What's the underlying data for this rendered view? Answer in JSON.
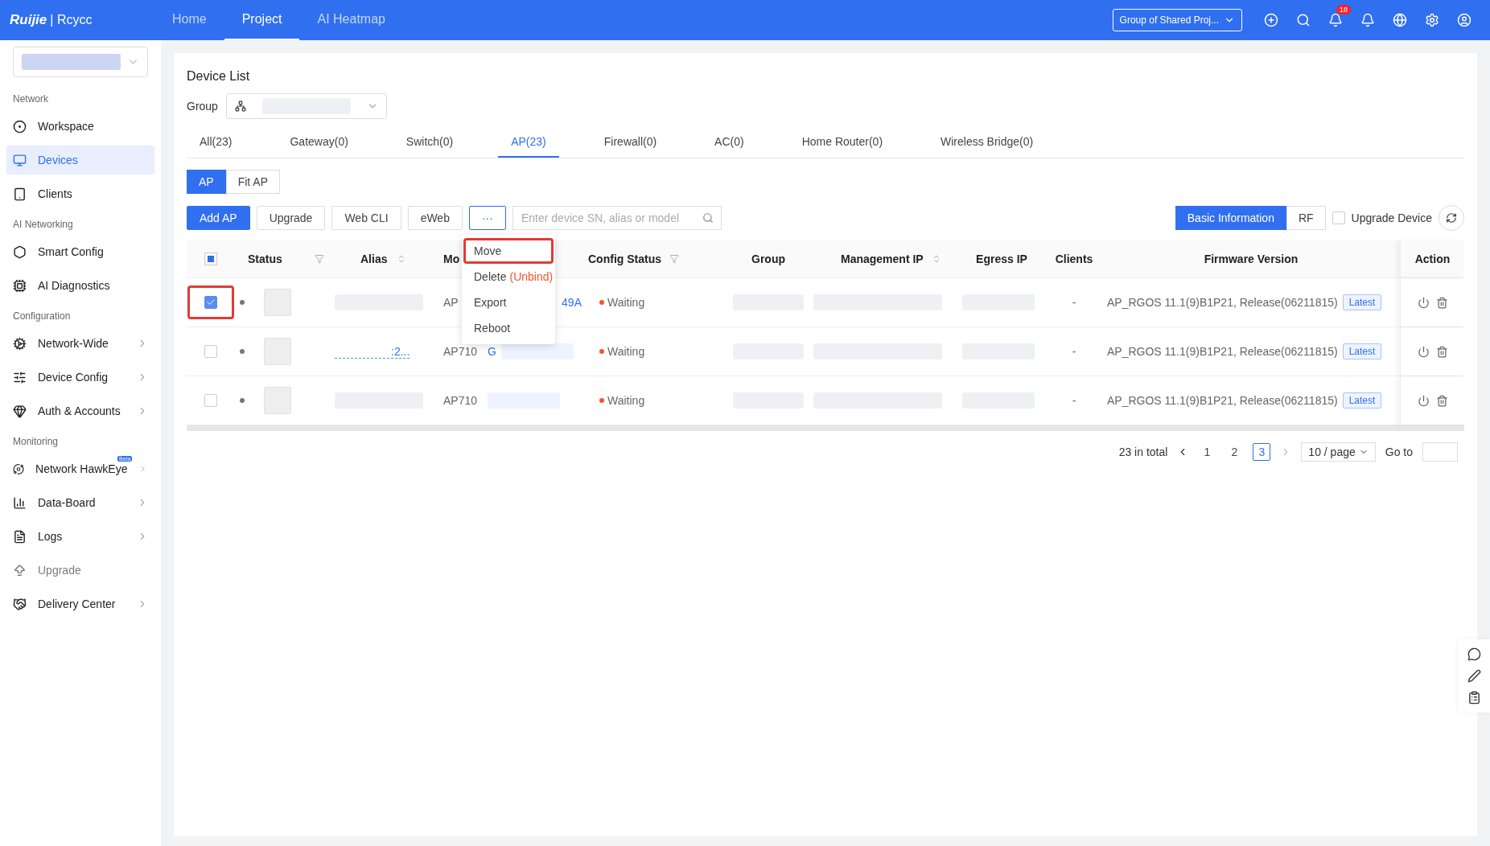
{
  "topbar": {
    "logo_left": "Ruijie",
    "logo_separator": "|",
    "logo_right": "Rcycc",
    "nav": [
      {
        "label": "Home",
        "selected": false
      },
      {
        "label": "Project",
        "selected": true
      },
      {
        "label": "AI Heatmap",
        "selected": false
      }
    ],
    "project_select": "Group of Shared Proj...",
    "notification_count": "18"
  },
  "sidebar": {
    "sections": [
      {
        "title": "Network",
        "items": [
          {
            "label": "Workspace",
            "selected": false,
            "chevron": false,
            "disabled": false
          },
          {
            "label": "Devices",
            "selected": true,
            "chevron": false,
            "disabled": false
          },
          {
            "label": "Clients",
            "selected": false,
            "chevron": false,
            "disabled": false
          }
        ]
      },
      {
        "title": "AI Networking",
        "items": [
          {
            "label": "Smart Config",
            "selected": false,
            "chevron": false,
            "disabled": false
          },
          {
            "label": "AI Diagnostics",
            "selected": false,
            "chevron": false,
            "disabled": false
          }
        ]
      },
      {
        "title": "Configuration",
        "items": [
          {
            "label": "Network-Wide",
            "selected": false,
            "chevron": true,
            "disabled": false
          },
          {
            "label": "Device Config",
            "selected": false,
            "chevron": true,
            "disabled": false
          },
          {
            "label": "Auth & Accounts",
            "selected": false,
            "chevron": true,
            "disabled": false
          }
        ]
      },
      {
        "title": "Monitoring",
        "items": [
          {
            "label": "Network HawkEye",
            "badge": "Beta",
            "selected": false,
            "chevron": true,
            "disabled": false
          },
          {
            "label": "Data-Board",
            "selected": false,
            "chevron": true,
            "disabled": false
          },
          {
            "label": "Logs",
            "selected": false,
            "chevron": true,
            "disabled": false
          },
          {
            "label": "Upgrade",
            "selected": false,
            "chevron": false,
            "disabled": true
          },
          {
            "label": "Delivery Center",
            "selected": false,
            "chevron": true,
            "disabled": false
          }
        ]
      }
    ]
  },
  "page": {
    "title": "Device List",
    "group_label": "Group"
  },
  "tabs": [
    {
      "label": "All(23)",
      "selected": false
    },
    {
      "label": "Gateway(0)",
      "selected": false
    },
    {
      "label": "Switch(0)",
      "selected": false
    },
    {
      "label": "AP(23)",
      "selected": true
    },
    {
      "label": "Firewall(0)",
      "selected": false
    },
    {
      "label": "AC(0)",
      "selected": false
    },
    {
      "label": "Home Router(0)",
      "selected": false
    },
    {
      "label": "Wireless Bridge(0)",
      "selected": false
    }
  ],
  "subtabs": [
    {
      "label": "AP",
      "selected": true
    },
    {
      "label": "Fit AP",
      "selected": false
    }
  ],
  "toolbar": {
    "buttons": [
      {
        "label": "Add AP",
        "kind": "primary"
      },
      {
        "label": "Upgrade",
        "kind": "default"
      },
      {
        "label": "Web CLI",
        "kind": "default"
      },
      {
        "label": "eWeb",
        "kind": "default"
      },
      {
        "label": "···",
        "kind": "more"
      }
    ],
    "search_placeholder": "Enter device SN, alias or model",
    "views": [
      {
        "label": "Basic Information",
        "selected": true
      },
      {
        "label": "RF",
        "selected": false
      }
    ],
    "upgrade_device": {
      "label": "Upgrade Device",
      "checked": false
    }
  },
  "more_menu": [
    {
      "label": "Move",
      "highlighted": true
    },
    {
      "label": "Delete",
      "note": "(Unbind)",
      "highlighted": false
    },
    {
      "label": "Export",
      "highlighted": false
    },
    {
      "label": "Reboot",
      "highlighted": false
    }
  ],
  "table": {
    "header_checkbox_partial": true,
    "columns": [
      {
        "label": "Status",
        "filter": true,
        "sort": false
      },
      {
        "label": "Alias",
        "filter": false,
        "sort": true
      },
      {
        "label": "Mo"
      },
      {
        "label": "Config Status",
        "filter": true,
        "sort": false
      },
      {
        "label": "Group",
        "filter": false,
        "sort": false
      },
      {
        "label": "Management IP",
        "filter": false,
        "sort": true
      },
      {
        "label": "Egress IP",
        "filter": false,
        "sort": false
      },
      {
        "label": "Clients",
        "filter": false,
        "sort": false
      },
      {
        "label": "Firmware Version",
        "filter": false,
        "sort": false
      },
      {
        "label": "Action"
      }
    ],
    "rows": [
      {
        "checked": true,
        "outlined": true,
        "model": "AP",
        "sn": "49A",
        "config": "Waiting",
        "clients": "-",
        "firmware": "AP_RGOS 11.1(9)B1P21, Release(06211815)",
        "tag": "Latest"
      },
      {
        "checked": false,
        "outlined": false,
        "alias": ":2...",
        "model": "AP710",
        "sn": "G",
        "config": "Waiting",
        "clients": "-",
        "firmware": "AP_RGOS 11.1(9)B1P21, Release(06211815)",
        "tag": "Latest"
      },
      {
        "checked": false,
        "outlined": false,
        "model": "AP710",
        "config": "Waiting",
        "clients": "-",
        "firmware": "AP_RGOS 11.1(9)B1P21, Release(06211815)",
        "tag": "Latest"
      }
    ]
  },
  "pagination": {
    "total": "23 in total",
    "pages": [
      {
        "label": "1",
        "selected": false
      },
      {
        "label": "2",
        "selected": false
      },
      {
        "label": "3",
        "selected": true
      }
    ],
    "page_size": "10 / page",
    "goto": "Go to"
  }
}
